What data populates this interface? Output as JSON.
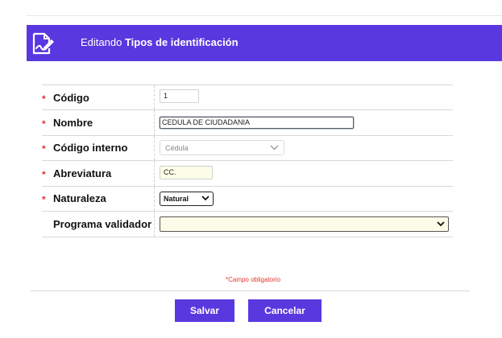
{
  "header": {
    "prefix": "Editando",
    "entity": "Tipos de identificación",
    "icon": "edit-document-icon",
    "color": "#5a38e0"
  },
  "fields": [
    {
      "label": "Código",
      "required": true,
      "value": "1"
    },
    {
      "label": "Nombre",
      "required": true,
      "value": "CEDULA DE CIUDADANIA"
    },
    {
      "label": "Código interno",
      "required": true,
      "value": "Cédula"
    },
    {
      "label": "Abreviatura",
      "required": true,
      "value": "CC."
    },
    {
      "label": "Naturaleza",
      "required": true,
      "value": "Natural"
    },
    {
      "label": "Programa validador",
      "required": false,
      "value": ""
    }
  ],
  "required_marker": "*",
  "required_note": "Campo obligatorio",
  "buttons": {
    "save": "Salvar",
    "cancel": "Cancelar"
  },
  "colors": {
    "accent": "#5a38e0",
    "required": "#e0362b",
    "input_highlight": "#fcfde8"
  }
}
